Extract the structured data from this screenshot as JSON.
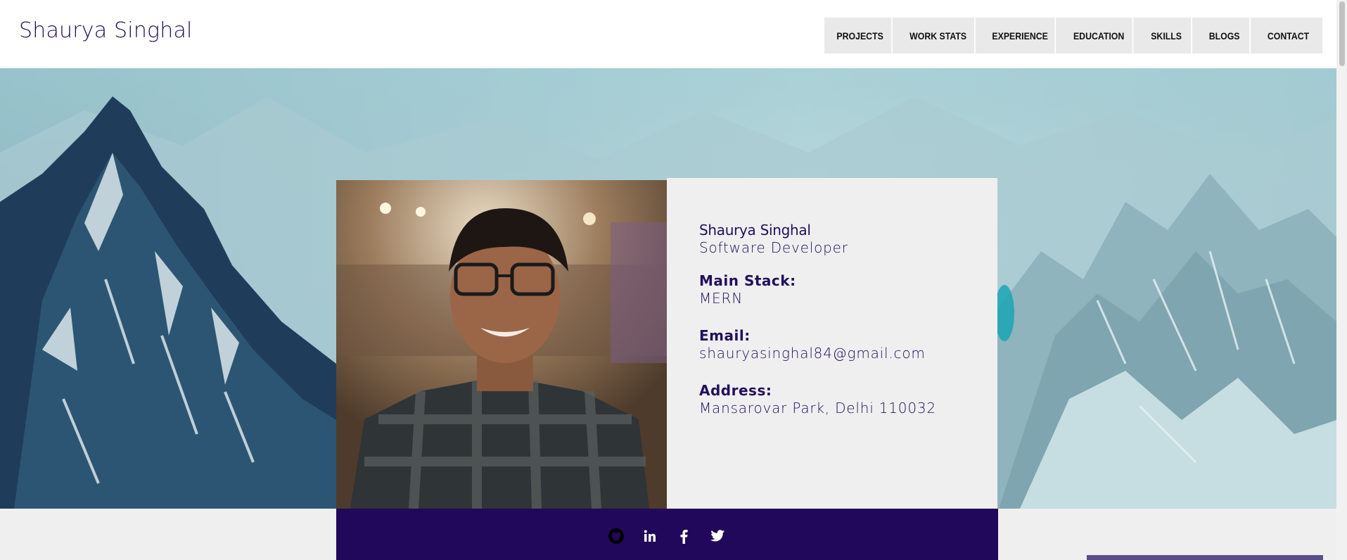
{
  "header": {
    "site_title": "Shaurya Singhal",
    "nav": [
      {
        "label": "PROJECTS"
      },
      {
        "label": "WORK STATS"
      },
      {
        "label": "EXPERIENCE"
      },
      {
        "label": "EDUCATION"
      },
      {
        "label": "SKILLS"
      },
      {
        "label": "BLOGS"
      },
      {
        "label": "CONTACT"
      }
    ]
  },
  "profile": {
    "name": "Shaurya Singhal",
    "title": "Software Developer",
    "stack_label": "Main Stack:",
    "stack_value": "MERN",
    "email_label": "Email:",
    "email_value": "shauryasinghal84@gmail.com",
    "address_label": "Address:",
    "address_value": "Mansarovar Park, Delhi 110032"
  },
  "social": [
    {
      "icon": "github-icon"
    },
    {
      "icon": "linkedin-icon"
    },
    {
      "icon": "facebook-icon"
    },
    {
      "icon": "twitter-icon"
    }
  ],
  "colors": {
    "brand": "#22105c",
    "social_bar": "#22085a",
    "nav_bg": "#e9e9e9",
    "card_bg": "#efefef"
  }
}
